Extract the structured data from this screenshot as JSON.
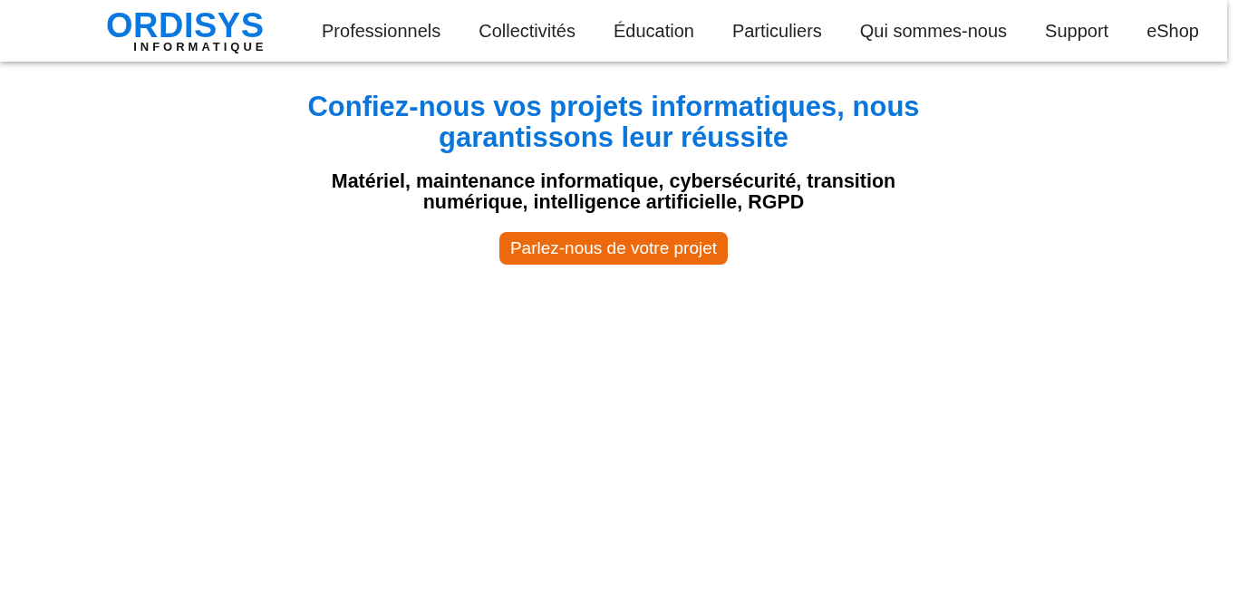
{
  "header": {
    "logo": {
      "wordmark": "ORDISYS",
      "tagline": "INFORMATIQUE"
    },
    "nav": [
      {
        "label": "Professionnels"
      },
      {
        "label": "Collectivités"
      },
      {
        "label": "Éducation"
      },
      {
        "label": "Particuliers"
      },
      {
        "label": "Qui sommes-nous"
      },
      {
        "label": "Support"
      },
      {
        "label": "eShop"
      }
    ]
  },
  "hero": {
    "title": "Confiez-nous vos projets informatiques, nous garantissons leur réussite",
    "subtitle": "Matériel, maintenance informatique, cybersécurité, transition numérique, intelligence artificielle, RGPD",
    "button": "Parlez-nous de votre projet"
  }
}
